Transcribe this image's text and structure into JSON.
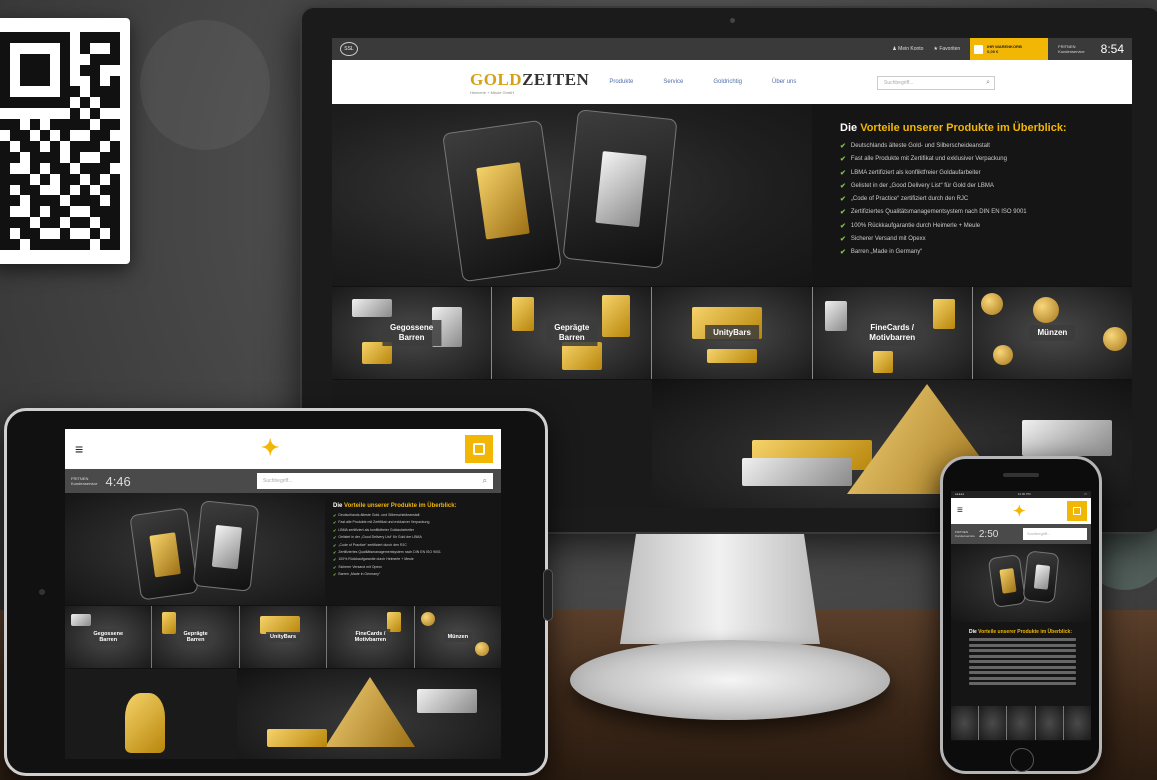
{
  "desktop": {
    "topbar": {
      "ssl_label": "SSL",
      "account_link": "♟ Mein Konto",
      "favorites_link": "★ Favoriten",
      "cart_title": "IHR WARENKORB",
      "cart_value": "0,00 €",
      "support_label": "Kundenservice",
      "support_label_top": "FRITNEN",
      "time": "8:54"
    },
    "header": {
      "logo_main": "GOLD",
      "logo_accent": "ZEITEN",
      "logo_sub": "Heimerle + Meule GmbH",
      "nav": [
        "Produkte",
        "Service",
        "Goldrichtig",
        "Über uns"
      ],
      "search_placeholder": "Suchbegriff..."
    },
    "hero": {
      "title_prefix": "Die ",
      "title_accent_1": "Vorteile",
      "title_rest": " unserer Produkte im Überblick:",
      "benefits": [
        "Deutschlands älteste Gold- und Silberscheideanstalt",
        "Fast alle Produkte mit Zertifikat und exklusiver Verpackung",
        "LBMA zertifiziert als konfliktfreier Goldaufarbeiter",
        "Gelistet in der „Good Delivery List“ für Gold der LBMA",
        "„Code of Practice“ zertifiziert durch den RJC",
        "Zertifiziertes Qualitätsmanagementsystem nach DIN EN ISO 9001",
        "100% Rückkaufgarantie durch Heimerle + Meule",
        "Sicherer Versand mit Opexx",
        "Barren „Made in Germany“"
      ]
    },
    "categories": [
      {
        "line1": "Gegossene",
        "line2": "Barren"
      },
      {
        "line1": "Geprägte",
        "line2": "Barren"
      },
      {
        "line1": "UnityBars",
        "line2": ""
      },
      {
        "line1": "FineCards /",
        "line2": "Motivbarren"
      },
      {
        "line1": "Münzen",
        "line2": ""
      }
    ]
  },
  "tablet": {
    "support_line1": "FRITNEN",
    "support_line2": "Kundenservice",
    "time": "4:46",
    "search_placeholder": "Suchbegriff...",
    "title_prefix": "Die ",
    "title_accent": "Vorteile unserer Produkte im Überblick:",
    "benefits": [
      "Deutschlands älteste Gold- und Silberscheideanstalt",
      "Fast alle Produkte mit Zertifikat und exklusiver Verpackung",
      "LBMA zertifiziert als konfliktfreier Goldaufarbeiter",
      "Gelistet in der „Good Delivery List“ für Gold der LBMA",
      "„Code of Practice“ zertifiziert durch den RJC",
      "Zertifiziertes Qualitätsmanagementsystem nach DIN EN ISO 9001",
      "100% Rückkaufgarantie durch Heimerle + Meule",
      "Sicherer Versand mit Opexx",
      "Barren „Made in Germany“"
    ],
    "categories": [
      {
        "line1": "Gegossene",
        "line2": "Barren"
      },
      {
        "line1": "Geprägte",
        "line2": "Barren"
      },
      {
        "line1": "UnityBars",
        "line2": ""
      },
      {
        "line1": "FineCards /",
        "line2": "Motivbarren"
      },
      {
        "line1": "Münzen",
        "line2": ""
      }
    ]
  },
  "phone": {
    "status_left": "●●●●●",
    "status_time": "12:00 PM",
    "status_right": "▭",
    "support_line1": "FRITNEN",
    "support_line2": "Kundenservice",
    "time": "2:50",
    "search_placeholder": "Suchbegriff...",
    "title_prefix": "Die ",
    "title_accent": "Vorteile unserer Produkte im Überblick:"
  },
  "colors": {
    "accent_gold": "#f2b705",
    "nav_blue": "#4f70a8",
    "check_green": "#7ec24a"
  },
  "icons": [
    "qr-code-icon",
    "ssl-badge-icon",
    "user-icon",
    "star-icon",
    "shopping-bag-icon",
    "search-icon",
    "hamburger-menu-icon",
    "gold-runner-logo-icon",
    "checkmark-icon"
  ]
}
